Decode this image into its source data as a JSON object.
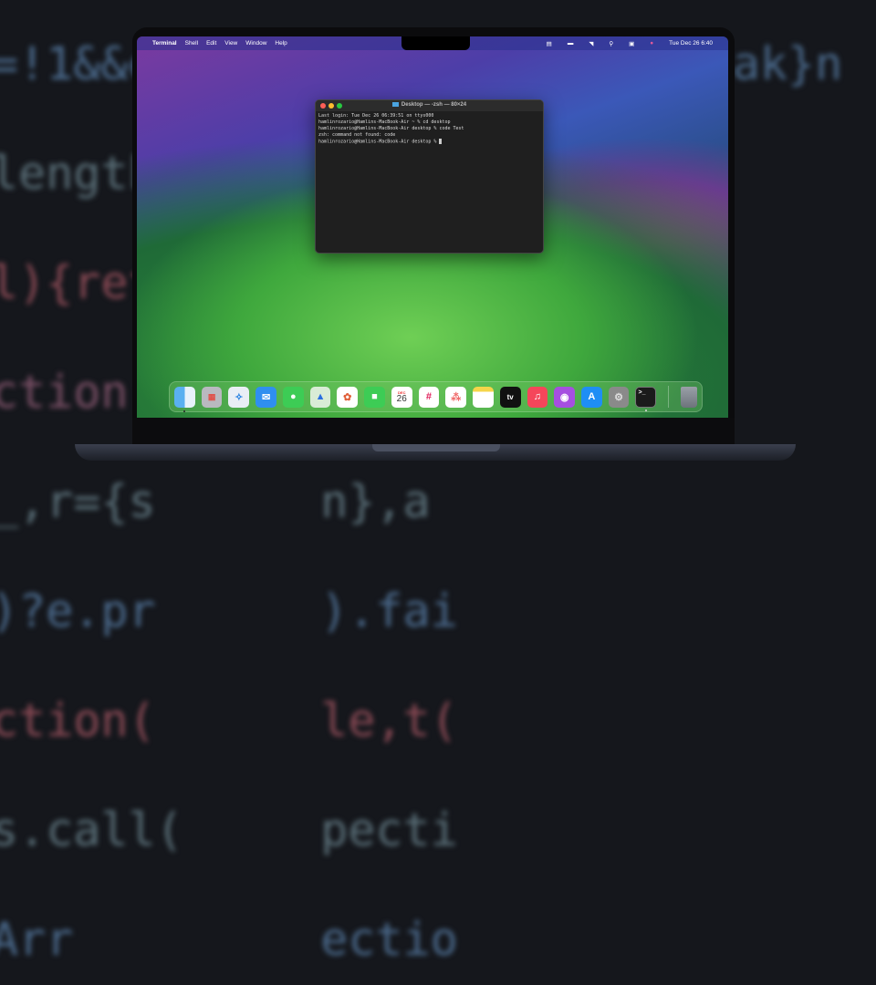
{
  "background_code": [
    "=!1&&e.stopOnFalse){r=l;break}n",
    "length:s   his},",
    "l){ret      ;functi",
    "ction(      s,arr",
    "_,r={s      n},a",
    ")?e.pr      ).fai",
    "ction(      le,t(",
    "s.call(     pecti",
    "Arr         ectio"
  ],
  "menubar": {
    "apple": "",
    "app": "Terminal",
    "items": [
      "Shell",
      "Edit",
      "View",
      "Window",
      "Help"
    ],
    "clock": "Tue Dec 26  6:40"
  },
  "terminal": {
    "title": "Desktop — -zsh — 80×24",
    "lines": [
      "Last login: Tue Dec 26 06:39:51 on ttys000",
      "hamlinrozario@Hamlins-MacBook-Air ~ % cd desktop",
      "hamlinrozario@Hamlins-MacBook-Air desktop % code Test",
      "zsh: command not found: code",
      "hamlinrozario@Hamlins-MacBook-Air desktop % "
    ]
  },
  "dock": {
    "calendar_month": "DEC",
    "calendar_day": "26",
    "tv_label": "tv",
    "items": [
      "Finder",
      "Launchpad",
      "Safari",
      "Mail",
      "Messages",
      "Maps",
      "Photos",
      "FaceTime",
      "Calendar",
      "Slack",
      "Asana",
      "Notes",
      "TV",
      "Music",
      "Podcasts",
      "App Store",
      "System Settings",
      "Terminal",
      "Trash"
    ]
  }
}
